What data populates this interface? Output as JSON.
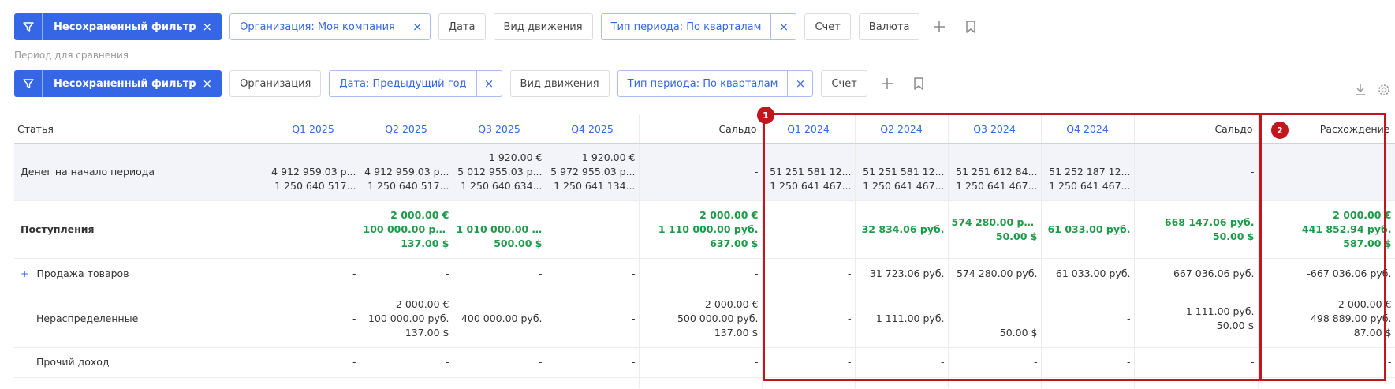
{
  "filters_main": {
    "primary_label": "Несохраненный фильтр",
    "chips": [
      {
        "label": "Организация: Моя компания",
        "active": true
      },
      {
        "label": "Дата",
        "active": false
      },
      {
        "label": "Вид движения",
        "active": false
      },
      {
        "label": "Тип периода: По кварталам",
        "active": true
      },
      {
        "label": "Счет",
        "active": false
      },
      {
        "label": "Валюта",
        "active": false
      }
    ]
  },
  "comparison": {
    "subtitle": "Период для сравнения",
    "primary_label": "Несохраненный фильтр",
    "chips": [
      {
        "label": "Организация",
        "active": false
      },
      {
        "label": "Дата: Предыдущий год",
        "active": true
      },
      {
        "label": "Вид движения",
        "active": false
      },
      {
        "label": "Тип периода: По кварталам",
        "active": true
      },
      {
        "label": "Счет",
        "active": false
      }
    ]
  },
  "table": {
    "headers": [
      "Статья",
      "Q1 2025",
      "Q2 2025",
      "Q3 2025",
      "Q4 2025",
      "Сальдо",
      "Q1 2024",
      "Q2 2024",
      "Q3 2024",
      "Q4 2024",
      "Сальдо",
      "Расхождение"
    ],
    "rows": [
      {
        "name": "Денег на начало периода",
        "cells": [
          [
            "",
            "4 912 959.03 р...",
            "1 250 640 517..."
          ],
          [
            "",
            "4 912 959.03 р...",
            "1 250 640 517..."
          ],
          [
            "1 920.00 €",
            "5 012 955.03 р...",
            "1 250 640 634..."
          ],
          [
            "1 920.00 €",
            "5 972 955.03 р...",
            "1 250 641 134..."
          ],
          [
            "-"
          ],
          [
            "",
            "51 251 581 12...",
            "1 250 641 467..."
          ],
          [
            "",
            "51 251 581 12...",
            "1 250 641 467..."
          ],
          [
            "",
            "51 251 612 84...",
            "1 250 641 467..."
          ],
          [
            "",
            "51 252 187 12...",
            "1 250 641 467..."
          ],
          [
            "-"
          ],
          [
            ""
          ]
        ]
      },
      {
        "name": "Поступления",
        "cells": [
          [
            "-"
          ],
          [
            "2 000.00 €",
            "100 000.00 руб.",
            "137.00 $"
          ],
          [
            "",
            "1 010 000.00 ...",
            "500.00 $"
          ],
          [
            "-"
          ],
          [
            "2 000.00 €",
            "1 110 000.00 руб.",
            "637.00 $"
          ],
          [
            "-"
          ],
          [
            "32 834.06 руб."
          ],
          [
            "574 280.00 руб.",
            "50.00 $"
          ],
          [
            "61 033.00 руб."
          ],
          [
            "668 147.06 руб.",
            "50.00 $"
          ],
          [
            "2 000.00 €",
            "441 852.94 руб.",
            "587.00 $"
          ]
        ]
      },
      {
        "name": "Продажа товаров",
        "expand": "+",
        "cells": [
          [
            "-"
          ],
          [
            "-"
          ],
          [
            "-"
          ],
          [
            "-"
          ],
          [
            "-"
          ],
          [
            "-"
          ],
          [
            "31 723.06 руб."
          ],
          [
            "574 280.00 руб."
          ],
          [
            "61 033.00 руб."
          ],
          [
            "667 036.06 руб."
          ],
          [
            "-667 036.06 руб."
          ]
        ]
      },
      {
        "name": "Нераспределенные",
        "cells": [
          [
            "-"
          ],
          [
            "2 000.00 €",
            "100 000.00 руб.",
            "137.00 $"
          ],
          [
            "400 000.00 руб."
          ],
          [
            "-"
          ],
          [
            "2 000.00 €",
            "500 000.00 руб.",
            "137.00 $"
          ],
          [
            "-"
          ],
          [
            "1 111.00 руб."
          ],
          [
            "",
            "",
            "50.00 $"
          ],
          [
            "-"
          ],
          [
            "1 111.00 руб.",
            "50.00 $"
          ],
          [
            "2 000.00 €",
            "498 889.00 руб.",
            "87.00 $"
          ]
        ]
      },
      {
        "name": "Прочий доход",
        "cells": [
          [
            "-"
          ],
          [
            "-"
          ],
          [
            "-"
          ],
          [
            "-"
          ],
          [
            "-"
          ],
          [
            "-"
          ],
          [
            "-"
          ],
          [
            "-"
          ],
          [
            "-"
          ],
          [
            "-"
          ],
          [
            "-"
          ]
        ]
      }
    ]
  },
  "annotations": [
    {
      "label": "1"
    },
    {
      "label": "2"
    }
  ],
  "colors": {
    "accent": "#3566e6",
    "positive": "#1e9b4a",
    "highlight": "#c0161c"
  }
}
